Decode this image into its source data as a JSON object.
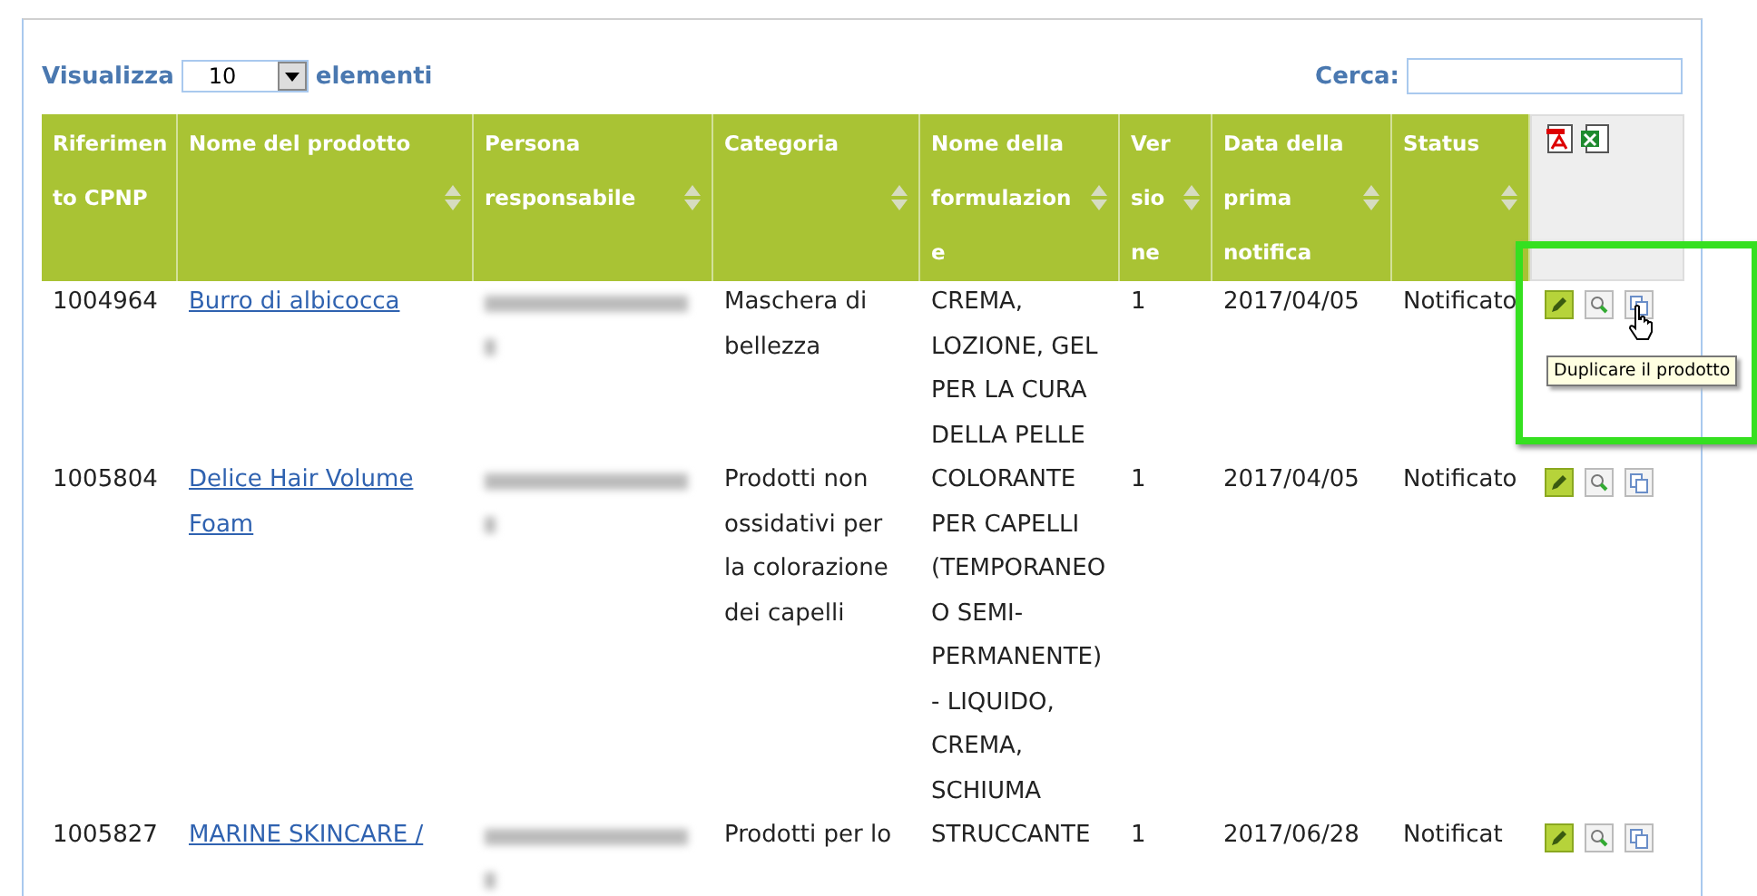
{
  "toolbar": {
    "show_label": "Visualizza",
    "page_size": "10",
    "entries_label": "elementi",
    "search_label": "Cerca:"
  },
  "columns": [
    {
      "label": "Riferimento CPNP",
      "sortable": false
    },
    {
      "label": "Nome del prodotto",
      "sortable": true
    },
    {
      "label": "Persona responsabile",
      "sortable": true
    },
    {
      "label": "Categoria",
      "sortable": true
    },
    {
      "label": "Nome della formulazione",
      "sortable": true
    },
    {
      "label": "Versione",
      "sortable": true
    },
    {
      "label": "Data della prima notifica",
      "sortable": true
    },
    {
      "label": "Status",
      "sortable": true
    }
  ],
  "rows": [
    {
      "reference": "1004964",
      "product": "Burro di albicocca",
      "category": "Maschera di bellezza",
      "formulation": "CREMA, LOZIONE, GEL PER LA CURA DELLA PELLE",
      "version": "1",
      "date": "2017/04/05",
      "status": "Notificato",
      "highlighted": true,
      "tooltip": "Duplicare il prodotto"
    },
    {
      "reference": "1005804",
      "product": "Delice Hair Volume Foam",
      "category": "Prodotti non ossidativi per la colorazione dei capelli",
      "formulation": "COLORANTE PER CAPELLI (TEMPORANEO O SEMI-PERMANENTE) - LIQUIDO, CREMA, SCHIUMA",
      "version": "1",
      "date": "2017/04/05",
      "status": "Notificato",
      "highlighted": false
    },
    {
      "reference": "1005827",
      "product": "MARINE SKINCARE /",
      "category": "Prodotti per lo",
      "formulation": "STRUCCANTE",
      "version": "1",
      "date": "2017/06/28",
      "status": "Notificat",
      "highlighted": false
    }
  ]
}
